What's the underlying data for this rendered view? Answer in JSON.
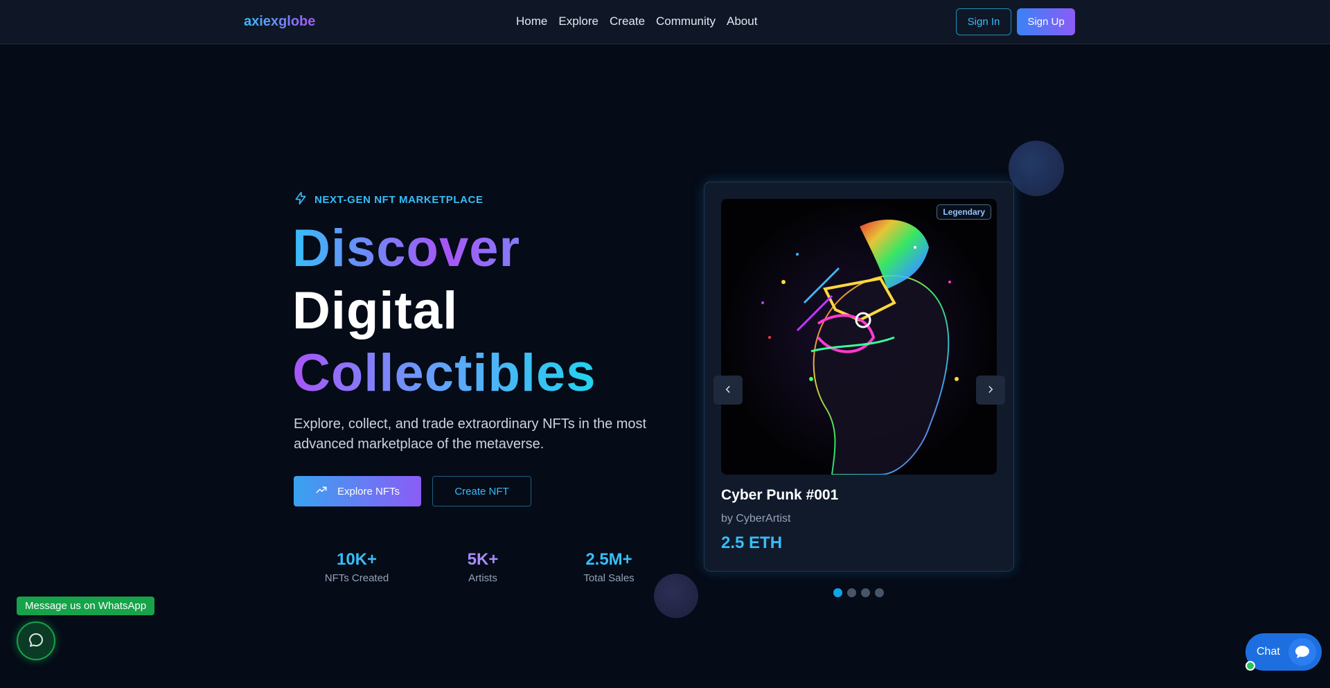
{
  "header": {
    "logo": "axiexglobe",
    "nav": [
      "Home",
      "Explore",
      "Create",
      "Community",
      "About"
    ],
    "sign_in": "Sign In",
    "sign_up": "Sign Up"
  },
  "hero": {
    "tagline": "NEXT-GEN NFT MARKETPLACE",
    "headline": [
      "Discover",
      "Digital",
      "Collectibles"
    ],
    "subtext": "Explore, collect, and trade extraordinary NFTs in the most advanced marketplace of the metaverse.",
    "explore_button": "Explore NFTs",
    "create_button": "Create NFT",
    "stats": [
      {
        "value": "10K+",
        "label": "NFTs Created",
        "color": "#38bdf8"
      },
      {
        "value": "5K+",
        "label": "Artists",
        "color": "#a78bfa"
      },
      {
        "value": "2.5M+",
        "label": "Total Sales",
        "color": "#38bdf8"
      }
    ]
  },
  "card": {
    "badge": "Legendary",
    "title": "Cyber Punk #001",
    "artist": "by CyberArtist",
    "price": "2.5 ETH",
    "slide_count": 4,
    "active_slide": 1
  },
  "widgets": {
    "whatsapp_label": "Message us on WhatsApp",
    "chat_label": "Chat"
  },
  "colors": {
    "background": "#050b17",
    "accent": "#38bdf8",
    "purple": "#a855f7",
    "whatsapp": "#16a34a",
    "chat": "#1d6fe0"
  }
}
